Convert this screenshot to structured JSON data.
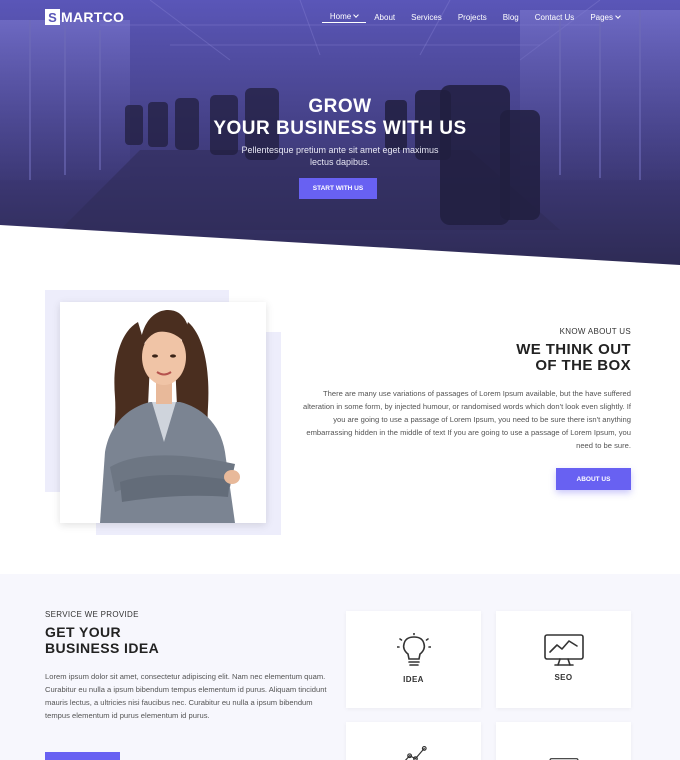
{
  "brand": {
    "logo_letter": "S",
    "logo_rest": "MARTCO"
  },
  "nav": {
    "items": [
      {
        "label": "Home",
        "dropdown": true,
        "active": true
      },
      {
        "label": "About"
      },
      {
        "label": "Services"
      },
      {
        "label": "Projects"
      },
      {
        "label": "Blog"
      },
      {
        "label": "Contact Us"
      },
      {
        "label": "Pages",
        "dropdown": true
      }
    ]
  },
  "hero": {
    "title_line1": "GROW",
    "title_line2": "YOUR BUSINESS WITH US",
    "subtitle_line1": "Pellentesque pretium ante sit amet eget maximus",
    "subtitle_line2": "lectus dapibus.",
    "cta": "START WITH US"
  },
  "about": {
    "kicker": "KNOW ABOUT US",
    "title_line1": "WE THINK OUT",
    "title_line2": "OF THE BOX",
    "body": "There are many use variations of passages of Lorem Ipsum available, but the have suffered alteration in some form, by injected humour, or randomised words which don't look even slightly. If you are going to use a passage of Lorem Ipsum, you need to be sure there isn't anything embarrassing hidden in the middle of text If you are going to use a passage of Lorem Ipsum, you need to be sure.",
    "cta": "ABOUT US"
  },
  "services": {
    "kicker": "SERVICE WE PROVIDE",
    "title_line1": "GET YOUR",
    "title_line2": "BUSINESS IDEA",
    "body": "Lorem ipsum dolor sit amet, consectetur adipiscing elit. Nam nec elementum quam. Curabitur eu nulla a ipsum bibendum tempus elementum id purus. Aliquam tincidunt mauris lectus, a ultricies nisi faucibus nec. Curabitur eu nulla a ipsum bibendum tempus elementum id purus elementum id purus.",
    "cards": [
      {
        "label": "IDEA",
        "icon": "lightbulb-icon"
      },
      {
        "label": "SEO",
        "icon": "monitor-chart-icon"
      },
      {
        "label": "",
        "icon": "line-graph-icon"
      },
      {
        "label": "",
        "icon": "web-globe-icon"
      }
    ]
  },
  "colors": {
    "accent": "#6861f2",
    "hero_overlay": "#4b4794",
    "soft_bg": "#ededfb",
    "section_bg": "#f7f7fd"
  }
}
